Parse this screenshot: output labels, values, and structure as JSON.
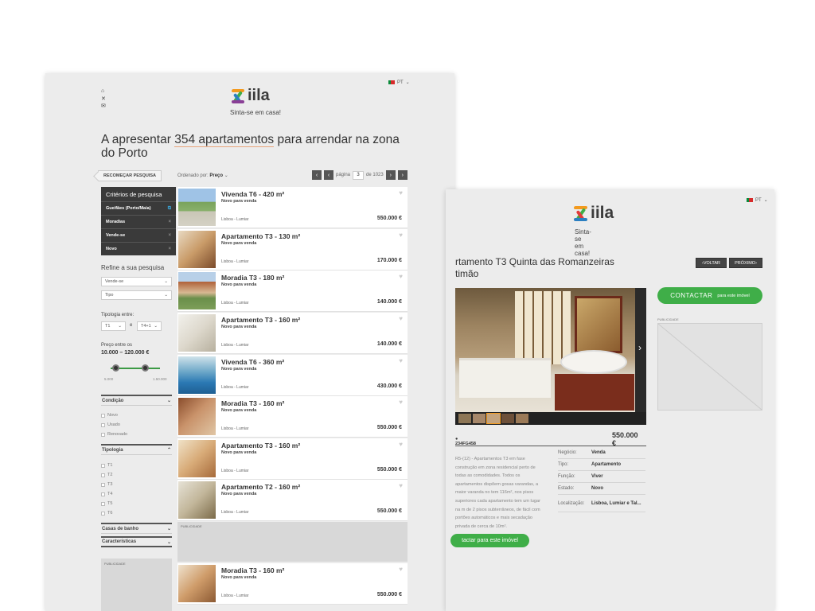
{
  "page1": {
    "logo_text": "iila",
    "tagline": "Sinta-se em casa!",
    "lang": "PT",
    "title_pre": "A apresentar ",
    "title_hl": "354 apartamentos",
    "title_post": " para arrendar na zona do Porto",
    "restart_label": "RECOMEÇAR PESQUISA",
    "order_label": "Ordenado por:",
    "order_value": "Preço",
    "page_label": "página",
    "page_current": "3",
    "page_total": "de 1023",
    "criteria_heading": "Critérios de pesquisa",
    "criteria": [
      "Gueifães (Porto/Maia)",
      "Moradias",
      "Vende-se",
      "Novo"
    ],
    "refine_heading": "Refine a sua pesquisa",
    "select_business": "Vende-se",
    "select_type": "Tipo",
    "tipologia_between": "Tipologia entre:",
    "tipologia_from": "T1",
    "tipologia_and": "e",
    "tipologia_to": "T4+1",
    "price_between": "Preço entre os",
    "price_range": "10.000 – 120.000 €",
    "range_min": "5.000",
    "range_max": "1.50.000",
    "condicao_label": "Condição",
    "condicao_options": [
      "Novo",
      "Usado",
      "Renovado"
    ],
    "tipologia_label": "Tipologia",
    "tipologia_options": [
      "T1",
      "T2",
      "T3",
      "T4",
      "T5",
      "T6"
    ],
    "casas_label": "Casas de banho",
    "caracteristicas_label": "Características",
    "ad_label": "PUBLICIDADE",
    "listings": [
      {
        "title": "Vivenda T6 - 420 m²",
        "sub": "Novo para venda",
        "loc": "Lisboa - Lumiar",
        "price": "550.000 €"
      },
      {
        "title": "Apartamento T3 - 130 m²",
        "sub": "Novo para venda",
        "loc": "Lisboa - Lumiar",
        "price": "170.000 €"
      },
      {
        "title": "Moradia T3 - 180 m²",
        "sub": "Novo para venda",
        "loc": "Lisboa - Lumiar",
        "price": "140.000 €"
      },
      {
        "title": "Apartamento T3 - 160 m²",
        "sub": "Novo para venda",
        "loc": "Lisboa - Lumiar",
        "price": "140.000 €"
      },
      {
        "title": "Vivenda T6 - 360 m²",
        "sub": "Novo para venda",
        "loc": "Lisboa - Lumiar",
        "price": "430.000 €"
      },
      {
        "title": "Moradia T3 - 160 m²",
        "sub": "Novo para venda",
        "loc": "Lisboa - Lumiar",
        "price": "550.000 €"
      },
      {
        "title": "Apartamento T3 - 160 m²",
        "sub": "Novo para venda",
        "loc": "Lisboa - Lumiar",
        "price": "550.000 €"
      },
      {
        "title": "Apartamento T2 - 160 m²",
        "sub": "Novo para venda",
        "loc": "Lisboa - Lumiar",
        "price": "550.000 €"
      },
      {
        "title": "Moradia T3 - 160 m²",
        "sub": "Novo para venda",
        "loc": "Lisboa - Lumiar",
        "price": "550.000 €"
      }
    ]
  },
  "page2": {
    "logo_text": "iila",
    "tagline": "Sinta-se em casa!",
    "lang": "PT",
    "title": "rtamento T3 Quinta das Romanzeiras\ntimão",
    "back_label": "VOLTAR",
    "next_label": "PRÓXIMO",
    "contact_label": "CONTACTAR",
    "contact_sub": "para este imóvel",
    "ad_label": "PUBLICIDADE",
    "ref": "234FG458",
    "price": "550.000 €",
    "description": "R5-(12) - Apartamentos T3 em fase construção em zona residencial perto de todas as comodidades. Todos os apartamentos dispõem gosas varandas, a maior varanda no tem 116m², nos pisos superiores cada apartamento tem um lugar na m de 2 pisos subterrâneos, de fácil com portões automáticos e mais secadação privada de cerca de 10m².",
    "contact_small": "tactar para este imóvel",
    "info": [
      {
        "k": "Negócio:",
        "v": "Venda"
      },
      {
        "k": "Tipo:",
        "v": "Apartamento"
      },
      {
        "k": "Função:",
        "v": "Viver"
      },
      {
        "k": "Estado:",
        "v": "Novo"
      },
      {
        "k": "Localização:",
        "v": "Lisboa, Lumiar e Tal..."
      }
    ]
  },
  "colors": {
    "accent_green": "#3fae48",
    "dark": "#3a3a3a",
    "logo_orange": "#f39a1e",
    "logo_green": "#3fae48",
    "logo_blue": "#2b7fc1",
    "logo_purple": "#8a3f96",
    "logo_red": "#e23b3b"
  }
}
